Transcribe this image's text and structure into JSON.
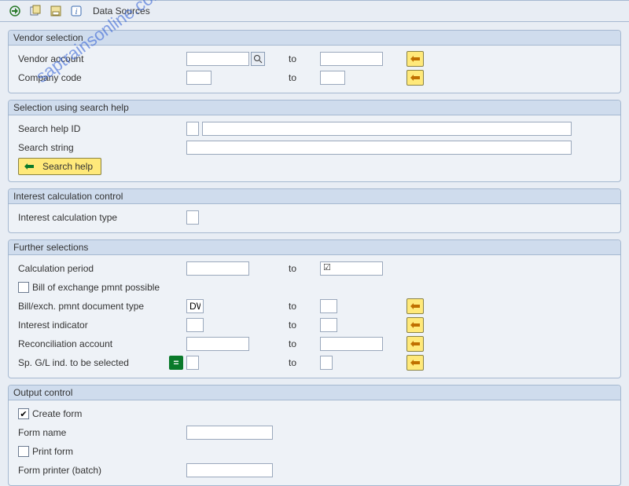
{
  "watermark": "saptrainsonline.com",
  "toolbar": {
    "execute": "execute-icon",
    "variant": "variant-icon",
    "save": "save-icon",
    "info": "info-icon",
    "data_sources_label": "Data Sources"
  },
  "groups": {
    "vendor_selection": {
      "title": "Vendor selection",
      "vendor_account_label": "Vendor account",
      "company_code_label": "Company code",
      "to_label": "to"
    },
    "search_help": {
      "title": "Selection using search help",
      "search_help_id_label": "Search help ID",
      "search_string_label": "Search string",
      "search_help_btn": "Search help"
    },
    "interest_control": {
      "title": "Interest calculation control",
      "calc_type_label": "Interest calculation type"
    },
    "further": {
      "title": "Further selections",
      "calc_period_label": "Calculation period",
      "boe_possible_label": "Bill of exchange pmnt possible",
      "bill_doc_type_label": "Bill/exch. pmnt document type",
      "bill_doc_type_value": "DW",
      "interest_indicator_label": "Interest indicator",
      "recon_account_label": "Reconciliation account",
      "sp_gl_label": "Sp. G/L ind. to be selected",
      "to_label": "to"
    },
    "output": {
      "title": "Output control",
      "create_form_label": "Create form",
      "create_form_checked": true,
      "form_name_label": "Form name",
      "print_form_label": "Print form",
      "print_form_checked": false,
      "form_printer_label": "Form printer (batch)"
    }
  }
}
